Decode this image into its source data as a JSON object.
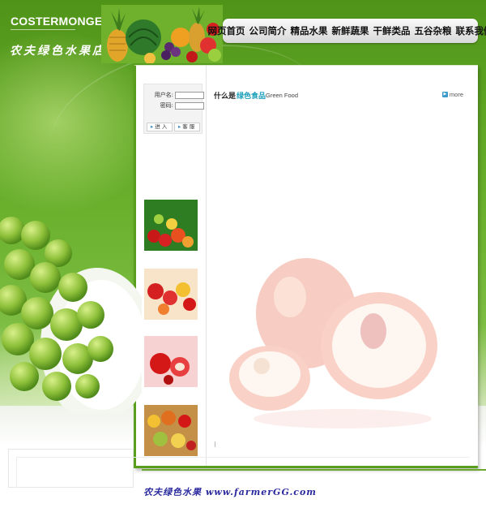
{
  "logo": {
    "english": "COSTERMONGER",
    "chinese": "农夫绿色水果店"
  },
  "nav": {
    "items": [
      "网页首页",
      "公司简介",
      "精品水果",
      "新鲜蔬果",
      "干鲜类品",
      "五谷杂粮",
      "联系我们"
    ]
  },
  "login": {
    "username_label": "用户名:",
    "password_label": "密码:",
    "login_button": "进 入",
    "register_button": "客 服"
  },
  "section": {
    "heading_prefix": "什么是",
    "heading_highlight": "绿色食品",
    "heading_english": "Green Food",
    "more_label": "more"
  },
  "footer": {
    "logo_text": "农夫绿色水果 www.farmerGG.com"
  },
  "colors": {
    "brand_green": "#5a9e1e",
    "accent_teal": "#1a9fb8",
    "more_icon": "#3b9ac8",
    "footer_text": "#2a2a9e"
  }
}
